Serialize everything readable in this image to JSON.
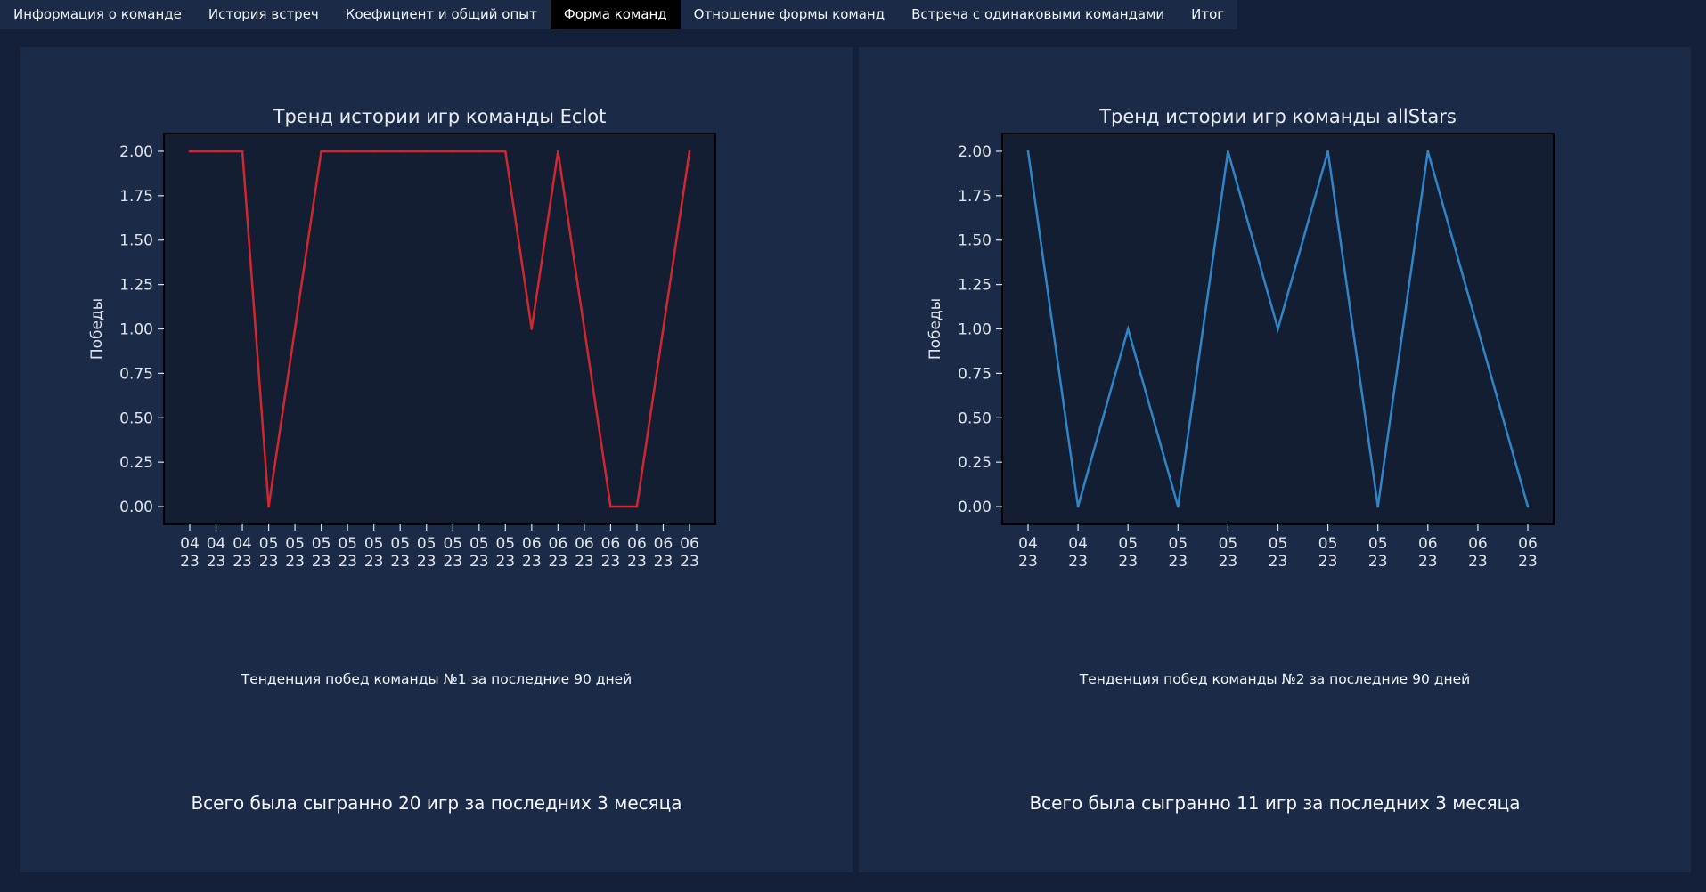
{
  "tabs": [
    {
      "label": "Информация о команде",
      "active": false
    },
    {
      "label": "История встреч",
      "active": false
    },
    {
      "label": "Коефициент и общий опыт",
      "active": false
    },
    {
      "label": "Форма команд",
      "active": true
    },
    {
      "label": "Отношение формы команд",
      "active": false
    },
    {
      "label": "Встреча с одинаковыми командами",
      "active": false
    },
    {
      "label": "Итог",
      "active": false
    }
  ],
  "panels": [
    {
      "caption": "Тенденция побед команды №1 за последние 90 дней",
      "summary": "Всего была сыгранно 20 игр за последних 3 месяца"
    },
    {
      "caption": "Тенденция побед команды №2 за последние 90 дней",
      "summary": "Всего была сыгранно 11 игр за последних 3 месяца"
    }
  ],
  "chart_data": [
    {
      "type": "line",
      "title": "Тренд истории игр команды Eclot",
      "xlabel": "",
      "ylabel": "Победы",
      "ylim": [
        -0.1,
        2.1
      ],
      "yticks": [
        "0.00",
        "0.25",
        "0.50",
        "0.75",
        "1.00",
        "1.25",
        "1.50",
        "1.75",
        "2.00"
      ],
      "categories": [
        "04\n23",
        "04\n23",
        "04\n23",
        "05\n23",
        "05\n23",
        "05\n23",
        "05\n23",
        "05\n23",
        "05\n23",
        "05\n23",
        "05\n23",
        "05\n23",
        "05\n23",
        "06\n23",
        "06\n23",
        "06\n23",
        "06\n23",
        "06\n23",
        "06\n23",
        "06\n23"
      ],
      "series": [
        {
          "values": [
            2,
            2,
            2,
            0,
            1,
            2,
            2,
            2,
            2,
            2,
            2,
            2,
            2,
            1,
            2,
            1,
            0,
            0,
            1,
            2
          ],
          "color": "#d0282e"
        }
      ],
      "grid": false
    },
    {
      "type": "line",
      "title": "Тренд истории игр команды allStars",
      "xlabel": "",
      "ylabel": "Победы",
      "ylim": [
        -0.1,
        2.1
      ],
      "yticks": [
        "0.00",
        "0.25",
        "0.50",
        "0.75",
        "1.00",
        "1.25",
        "1.50",
        "1.75",
        "2.00"
      ],
      "categories": [
        "04\n23",
        "04\n23",
        "05\n23",
        "05\n23",
        "05\n23",
        "05\n23",
        "05\n23",
        "05\n23",
        "06\n23",
        "06\n23",
        "06\n23"
      ],
      "series": [
        {
          "values": [
            2,
            0,
            1,
            0,
            2,
            1,
            2,
            0,
            2,
            1,
            0
          ],
          "color": "#2e86c9"
        }
      ],
      "grid": false
    }
  ],
  "colors": {
    "background": "#14203a",
    "panel": "#1b2b47",
    "plot_area": "#141e33",
    "active_tab": "#000000"
  }
}
